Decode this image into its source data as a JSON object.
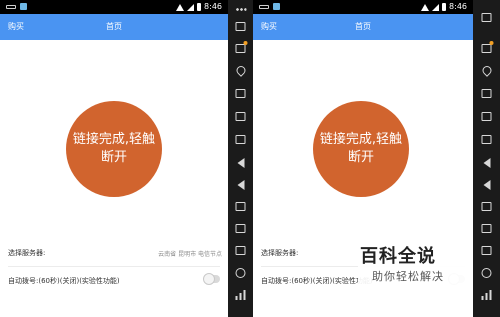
{
  "status_bar": {
    "time": "8:46"
  },
  "app_bar": {
    "buy_label": "购买",
    "title": "首页"
  },
  "connect_button": {
    "line1": "链接完成,轻触",
    "line2": "断开"
  },
  "settings": {
    "server_label": "选择服务器:",
    "server_value": "云南省 昆明市 电信节点",
    "autodial_label": "自动拨号:(60秒)(关闭)(实验性功能)",
    "autodial_enabled": false
  },
  "emulator_toolbar": {
    "icons": [
      "more-dots-icon",
      "trash-icon",
      "screen-record-icon",
      "location-pin-icon",
      "keyboard-icon",
      "window-icon",
      "screenshot-icon",
      "volume-up-icon",
      "volume-down-icon",
      "camera-icon",
      "clipboard-icon",
      "share-icon",
      "scissors-icon",
      "signal-bars-icon",
      "menu-icon"
    ]
  },
  "watermark": {
    "title": "百科全说",
    "subtitle": "助你轻松解决"
  }
}
